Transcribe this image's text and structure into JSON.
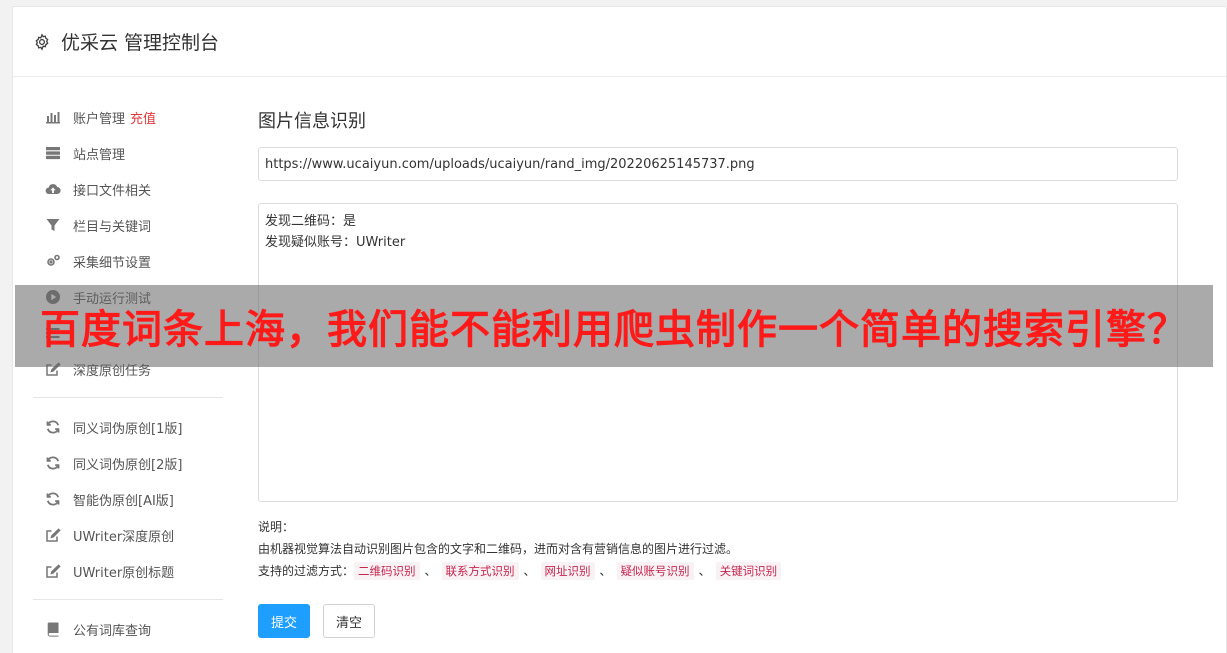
{
  "header": {
    "title": "优采云 管理控制台",
    "icon": "gear-icon"
  },
  "sidebar": {
    "groups": [
      [
        {
          "label": "账户管理",
          "extra": "充值",
          "icon": "bar-chart-icon"
        },
        {
          "label": "站点管理",
          "icon": "server-icon"
        },
        {
          "label": "接口文件相关",
          "icon": "cloud-upload-icon"
        },
        {
          "label": "栏目与关键词",
          "icon": "filter-icon"
        },
        {
          "label": "采集细节设置",
          "icon": "cogs-icon"
        },
        {
          "label": "手动运行测试",
          "icon": "play-circle-icon"
        },
        {
          "label": "",
          "icon": "list-icon"
        },
        {
          "label": "深度原创任务",
          "icon": "edit-icon"
        }
      ],
      [
        {
          "label": "同义词伪原创[1版]",
          "icon": "refresh-icon"
        },
        {
          "label": "同义词伪原创[2版]",
          "icon": "refresh-icon"
        },
        {
          "label": "智能伪原创[AI版]",
          "icon": "refresh-icon"
        },
        {
          "label": "UWriter深度原创",
          "icon": "edit-icon"
        },
        {
          "label": "UWriter原创标题",
          "icon": "edit-icon"
        }
      ],
      [
        {
          "label": "公有词库查询",
          "icon": "book-icon"
        }
      ]
    ]
  },
  "main": {
    "title": "图片信息识别",
    "url_value": "https://www.ucaiyun.com/uploads/ucaiyun/rand_img/20220625145737.png",
    "results": [
      "发现二维码：是",
      "发现疑似账号：UWriter"
    ],
    "desc_label": "说明：",
    "desc_text": "由机器视觉算法自动识别图片包含的文字和二维码，进而对含有营销信息的图片进行过滤。",
    "filter_label": "支持的过滤方式：",
    "filter_separator": "、",
    "filters": [
      "二维码识别",
      "联系方式识别",
      "网址识别",
      "疑似账号识别",
      "关键词识别"
    ],
    "submit_label": "提交",
    "clear_label": "清空"
  },
  "overlay": {
    "text": "百度词条上海，我们能不能利用爬虫制作一个简单的搜索引擎？"
  },
  "colors": {
    "primary": "#1e9fff",
    "recharge": "#e4393c",
    "tag_text": "#c7254e",
    "tag_bg": "#f9f2f4",
    "overlay_text": "#ff1a1a"
  }
}
